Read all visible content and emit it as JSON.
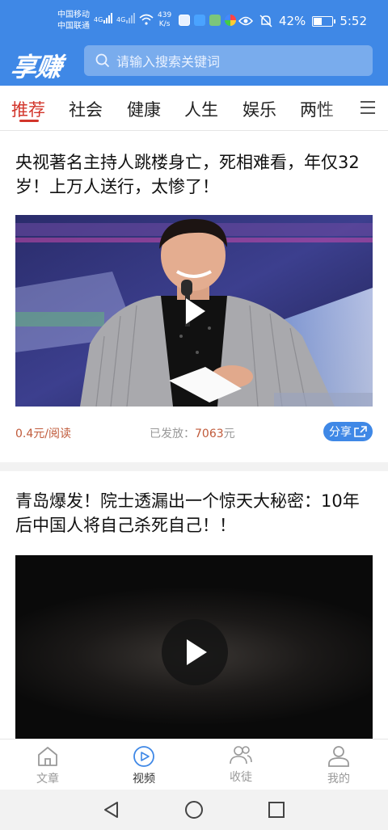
{
  "status": {
    "carrier1": "中国移动",
    "carrier2": "中国联通",
    "net1": "4G",
    "net2": "4G",
    "speed_value": "439",
    "speed_unit": "K/s",
    "battery": "42%",
    "time": "5:52"
  },
  "header": {
    "logo": "享赚",
    "search_placeholder": "请输入搜索关键词"
  },
  "tabs": [
    "推荐",
    "社会",
    "健康",
    "人生",
    "娱乐",
    "两性"
  ],
  "active_tab": 0,
  "articles": [
    {
      "title": "央视著名主持人跳楼身亡，死相难看，年仅32岁！上万人送行，太惨了！",
      "earn": "0.4元/阅读",
      "sent_label": "已发放：",
      "sent_value": "7063",
      "sent_unit": "元",
      "share": "分享"
    },
    {
      "title": "青岛爆发！院士透漏出一个惊天大秘密：10年后中国人将自己杀死自己！！"
    }
  ],
  "bottom_nav": [
    "文章",
    "视频",
    "收徒",
    "我的"
  ],
  "colors": {
    "primary": "#3f88e6",
    "accent_red": "#d2352b",
    "earn": "#c05a3a"
  }
}
